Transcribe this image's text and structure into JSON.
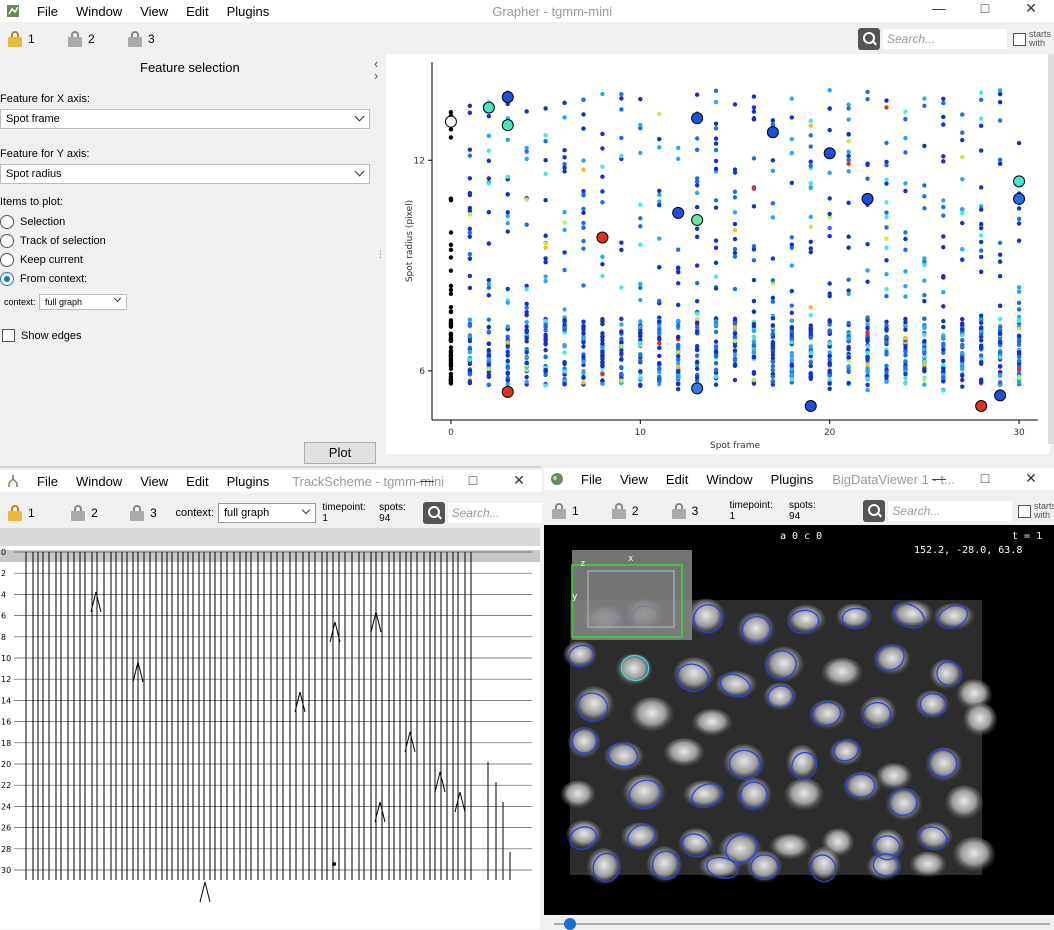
{
  "grapher": {
    "menu": [
      "File",
      "Window",
      "View",
      "Edit",
      "Plugins"
    ],
    "title": "Grapher - tgmm-mini",
    "locks": [
      "1",
      "2",
      "3"
    ],
    "search_placeholder": "Search...",
    "starts_with": "starts with",
    "feature_selection_title": "Feature selection",
    "x_axis_label": "Feature for X axis:",
    "x_axis_value": "Spot frame",
    "y_axis_label": "Feature for Y axis:",
    "y_axis_value": "Spot radius",
    "items_label": "Items to plot:",
    "radio_options": [
      "Selection",
      "Track of selection",
      "Keep current",
      "From context:"
    ],
    "selected_radio": "From context:",
    "context_label": "context:",
    "context_value": "full graph",
    "show_edges": "Show edges",
    "plot_button": "Plot"
  },
  "chart_data": {
    "type": "scatter",
    "xlabel": "Spot frame",
    "ylabel": "Spot radius (pixel)",
    "xlim": [
      -1,
      31
    ],
    "ylim": [
      4.6,
      14.8
    ],
    "x_ticks": [
      0,
      10,
      20,
      30
    ],
    "y_ticks": [
      6,
      12
    ],
    "color_scale": [
      "#1430c8",
      "#1e6fe6",
      "#2aa6f0",
      "#46e6e6",
      "#b8f04a",
      "#f0c020",
      "#e03020",
      "#000000"
    ],
    "frames": [
      0,
      1,
      2,
      3,
      4,
      5,
      6,
      7,
      8,
      9,
      10,
      11,
      12,
      13,
      14,
      15,
      16,
      17,
      18,
      19,
      20,
      21,
      22,
      23,
      24,
      25,
      26,
      27,
      28,
      29,
      30
    ],
    "highlight_points": [
      {
        "x": 0,
        "y": 13.1,
        "color": "#ffffff"
      },
      {
        "x": 2,
        "y": 13.5,
        "color": "#46e6c0"
      },
      {
        "x": 3,
        "y": 13.8,
        "color": "#1e50e0"
      },
      {
        "x": 3,
        "y": 13.0,
        "color": "#46e6c0"
      },
      {
        "x": 3,
        "y": 5.4,
        "color": "#e03020"
      },
      {
        "x": 8,
        "y": 9.8,
        "color": "#e03020"
      },
      {
        "x": 12,
        "y": 10.5,
        "color": "#1e50e0"
      },
      {
        "x": 13,
        "y": 13.2,
        "color": "#1e50e0"
      },
      {
        "x": 13,
        "y": 10.3,
        "color": "#6ae69a"
      },
      {
        "x": 13,
        "y": 5.5,
        "color": "#2a80e6"
      },
      {
        "x": 17,
        "y": 12.8,
        "color": "#1e50e0"
      },
      {
        "x": 19,
        "y": 5.0,
        "color": "#1e50e0"
      },
      {
        "x": 20,
        "y": 12.2,
        "color": "#1e50e0"
      },
      {
        "x": 22,
        "y": 10.9,
        "color": "#1e50e0"
      },
      {
        "x": 28,
        "y": 5.0,
        "color": "#e03020"
      },
      {
        "x": 29,
        "y": 5.3,
        "color": "#1e50e0"
      },
      {
        "x": 30,
        "y": 11.4,
        "color": "#46e6d0"
      },
      {
        "x": 30,
        "y": 10.9,
        "color": "#1e70e6"
      }
    ]
  },
  "trackscheme": {
    "menu": [
      "File",
      "Window",
      "View",
      "Edit",
      "Plugins"
    ],
    "title": "TrackScheme - tgmm-mini",
    "locks": [
      "1",
      "2",
      "3"
    ],
    "context_label": "context:",
    "context_value": "full graph",
    "timepoint": "timepoint: 1",
    "spots": "spots: 94",
    "search_placeholder": "Search...",
    "row_labels": [
      "0",
      "2",
      "4",
      "6",
      "8",
      "10",
      "12",
      "14",
      "16",
      "18",
      "20",
      "22",
      "24",
      "26",
      "28",
      "30"
    ]
  },
  "bdv": {
    "menu": [
      "File",
      "View",
      "Edit",
      "Window",
      "Plugins"
    ],
    "title": "BigDataViewer 1 - t...",
    "locks": [
      "1",
      "2",
      "3"
    ],
    "timepoint": "timepoint: 1",
    "spots": "spots: 94",
    "search_placeholder": "Search...",
    "starts_with": "starts with",
    "overlay_source": "a 0 c 0",
    "overlay_time": "t = 1",
    "overlay_coords": "152.2,  -28.0,   63.8",
    "axis_x": "x",
    "axis_y": "y",
    "axis_z": "z"
  }
}
